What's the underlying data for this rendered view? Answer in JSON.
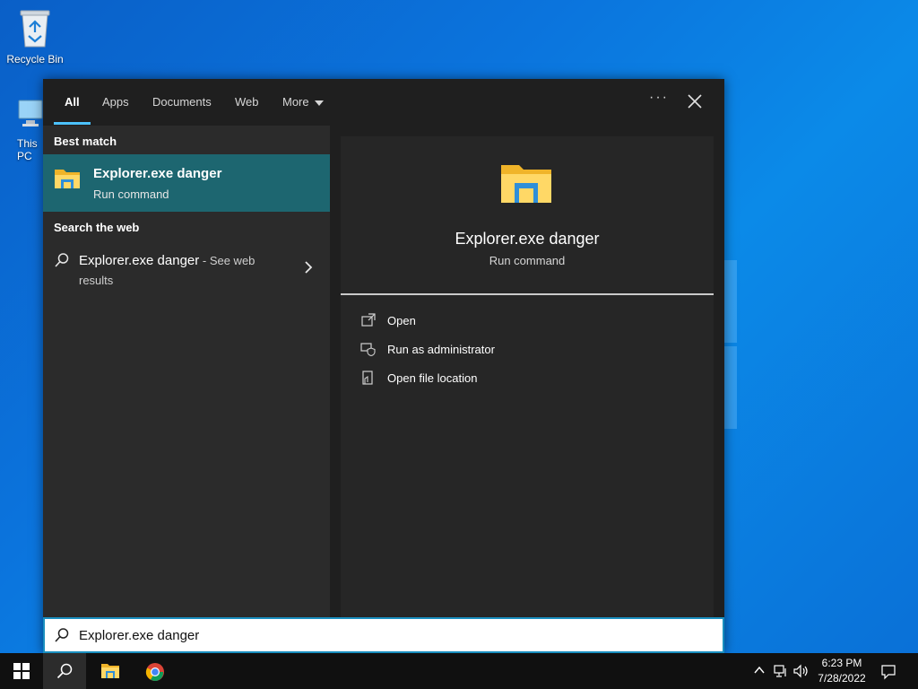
{
  "desktop": {
    "icons": [
      {
        "label": "Recycle Bin",
        "icon": "recycle-bin-icon"
      },
      {
        "label": "This PC",
        "icon": "this-pc-icon"
      }
    ]
  },
  "search_panel": {
    "tabs": [
      {
        "label": "All",
        "active": true
      },
      {
        "label": "Apps"
      },
      {
        "label": "Documents"
      },
      {
        "label": "Web"
      },
      {
        "label": "More"
      }
    ],
    "options_label": "···",
    "accent_color": "#4cc2ff",
    "best_match": {
      "heading": "Best match",
      "title": "Explorer.exe danger",
      "subtitle": "Run command",
      "icon": "folder-icon",
      "highlight_color": "#1d6670"
    },
    "web": {
      "heading": "Search the web",
      "query": "Explorer.exe danger",
      "suffix": " - See web",
      "suffix2": "results"
    },
    "preview": {
      "title": "Explorer.exe danger",
      "subtitle": "Run command",
      "actions": [
        {
          "label": "Open",
          "icon": "open-icon"
        },
        {
          "label": "Run as administrator",
          "icon": "shield-icon"
        },
        {
          "label": "Open file location",
          "icon": "file-location-icon"
        }
      ]
    },
    "search_input": {
      "value": "Explorer.exe danger"
    }
  },
  "taskbar": {
    "time": "6:23 PM",
    "date": "7/28/2022",
    "background": "#101010"
  }
}
